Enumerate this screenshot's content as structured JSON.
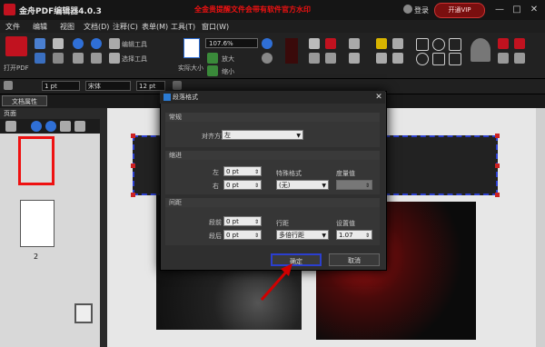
{
  "titlebar": {
    "app_title": "金舟PDF编辑器4.0.3",
    "ad_text": "全金贵提醒文件会带有软件官方水印",
    "login_label": "登录",
    "promo_label": "开通VIP",
    "minimize": "—",
    "maximize": "□",
    "close": "✕"
  },
  "menubar": {
    "items": [
      "文件",
      "编辑",
      "视图",
      "文档(D)",
      "注释(C)",
      "表单(M)",
      "工具(T)",
      "窗口(W)"
    ]
  },
  "toolbar": {
    "open_label": "打开PDF",
    "edit_tool_label": "编辑工具",
    "select_tool_label": "选择工具",
    "shrink_label": "实际大小",
    "zoom_value": "107.6%",
    "zoom_in_label": "放大",
    "zoom_out_label": "缩小"
  },
  "formatbar": {
    "line_width": "1 pt",
    "font_name": "宋体",
    "font_size": "12 pt"
  },
  "document_tab": {
    "label": "文档属性"
  },
  "thumbnails": {
    "header": "页面",
    "page2_number": "2"
  },
  "dialog": {
    "title": "段落格式",
    "section_general": "常规",
    "alignment_label": "对齐方式",
    "alignment_value": "左",
    "section_indent": "缩进",
    "left_label": "左",
    "left_value": "0 pt",
    "right_label": "右",
    "right_value": "0 pt",
    "special_label": "特殊格式",
    "special_value": "(无)",
    "measure_label": "度量值",
    "section_spacing": "间距",
    "before_label": "段前",
    "before_value": "0 pt",
    "after_label": "段后",
    "after_value": "0 pt",
    "line_spacing_label": "行距",
    "line_spacing_value": "多倍行距",
    "setting_label": "设置值",
    "setting_value": "1.07",
    "ok_label": "确定",
    "cancel_label": "取消"
  },
  "colors": {
    "brand_red": "#c1121f",
    "selection_blue": "#2b3fcf",
    "arrow_red": "#d00000"
  }
}
